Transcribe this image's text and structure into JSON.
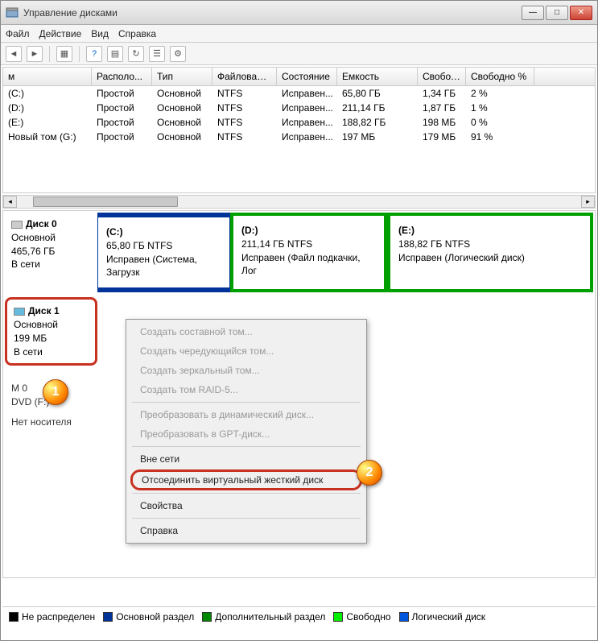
{
  "window": {
    "title": "Управление дисками"
  },
  "menu": {
    "file": "Файл",
    "action": "Действие",
    "view": "Вид",
    "help": "Справка"
  },
  "columns": {
    "vol": "м",
    "layout": "Располо...",
    "type": "Тип",
    "fs": "Файловая с...",
    "status": "Состояние",
    "capacity": "Емкость",
    "free": "Свобод...",
    "freepct": "Свободно %"
  },
  "volumes": [
    {
      "name": "(C:)",
      "layout": "Простой",
      "type": "Основной",
      "fs": "NTFS",
      "status": "Исправен...",
      "capacity": "65,80 ГБ",
      "free": "1,34 ГБ",
      "freepct": "2 %"
    },
    {
      "name": "(D:)",
      "layout": "Простой",
      "type": "Основной",
      "fs": "NTFS",
      "status": "Исправен...",
      "capacity": "211,14 ГБ",
      "free": "1,87 ГБ",
      "freepct": "1 %"
    },
    {
      "name": "(E:)",
      "layout": "Простой",
      "type": "Основной",
      "fs": "NTFS",
      "status": "Исправен...",
      "capacity": "188,82 ГБ",
      "free": "198 МБ",
      "freepct": "0 %"
    },
    {
      "name": "Новый том (G:)",
      "layout": "Простой",
      "type": "Основной",
      "fs": "NTFS",
      "status": "Исправен...",
      "capacity": "197 МБ",
      "free": "179 МБ",
      "freepct": "91 %"
    }
  ],
  "disk0": {
    "name": "Диск 0",
    "type": "Основной",
    "size": "465,76 ГБ",
    "status": "В сети",
    "parts": [
      {
        "name": "(C:)",
        "size": "65,80 ГБ NTFS",
        "status": "Исправен (Система, Загрузк"
      },
      {
        "name": "(D:)",
        "size": "211,14 ГБ NTFS",
        "status": "Исправен (Файл подкачки, Лог"
      },
      {
        "name": "(E:)",
        "size": "188,82 ГБ NTFS",
        "status": "Исправен (Логический диск)"
      }
    ]
  },
  "disk1": {
    "name": "Диск 1",
    "type": "Основной",
    "size": "199 МБ",
    "status": "В сети"
  },
  "cd0": {
    "name": "M 0",
    "dev": "DVD (F:)",
    "status": "Нет носителя"
  },
  "ctx": {
    "spanned": "Создать составной том...",
    "striped": "Создать чередующийся том...",
    "mirror": "Создать зеркальный том...",
    "raid5": "Создать том RAID-5...",
    "todyn": "Преобразовать в динамический диск...",
    "togpt": "Преобразовать в GPT-диск...",
    "offline": "Вне сети",
    "detach": "Отсоединить виртуальный жесткий диск",
    "props": "Свойства",
    "help": "Справка"
  },
  "legend": {
    "unalloc": "Не распределен",
    "primary": "Основной раздел",
    "extended": "Дополнительный раздел",
    "free": "Свободно",
    "logical": "Логический диск"
  },
  "callouts": {
    "one": "1",
    "two": "2"
  }
}
